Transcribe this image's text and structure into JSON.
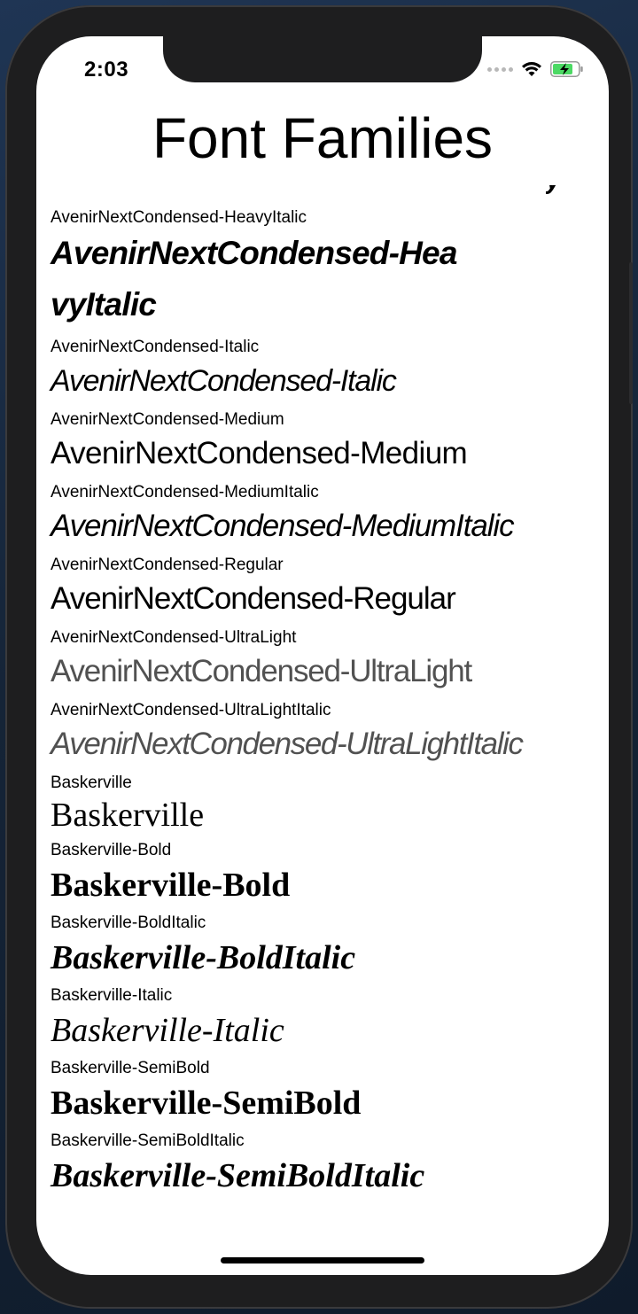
{
  "status_bar": {
    "time": "2:03"
  },
  "nav": {
    "title": "Font Families"
  },
  "fonts": [
    {
      "label": "AvenirNextCondensed-HeavyItalic",
      "sample": "AvenirNextCondensed-HeavyItalic"
    },
    {
      "label": "AvenirNextCondensed-Italic",
      "sample": "AvenirNextCondensed-Italic"
    },
    {
      "label": "AvenirNextCondensed-Medium",
      "sample": "AvenirNextCondensed-Medium"
    },
    {
      "label": "AvenirNextCondensed-MediumItalic",
      "sample": "AvenirNextCondensed-MediumItalic"
    },
    {
      "label": "AvenirNextCondensed-Regular",
      "sample": "AvenirNextCondensed-Regular"
    },
    {
      "label": "AvenirNextCondensed-UltraLight",
      "sample": "AvenirNextCondensed-UltraLight"
    },
    {
      "label": "AvenirNextCondensed-UltraLightItalic",
      "sample": "AvenirNextCondensed-UltraLightItalic"
    },
    {
      "label": "Baskerville",
      "sample": "Baskerville"
    },
    {
      "label": "Baskerville-Bold",
      "sample": "Baskerville-Bold"
    },
    {
      "label": "Baskerville-BoldItalic",
      "sample": "Baskerville-BoldItalic"
    },
    {
      "label": "Baskerville-Italic",
      "sample": "Baskerville-Italic"
    },
    {
      "label": "Baskerville-SemiBold",
      "sample": "Baskerville-SemiBold"
    },
    {
      "label": "Baskerville-SemiBoldItalic",
      "sample": "Baskerville-SemiBoldItalic"
    }
  ],
  "colors": {
    "background": "#ffffff",
    "text": "#000000",
    "battery_fill": "#4cd964"
  }
}
